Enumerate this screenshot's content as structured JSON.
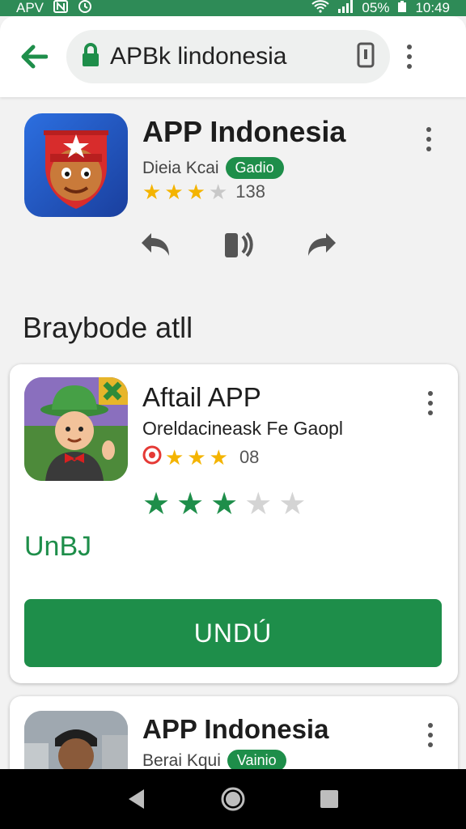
{
  "status": {
    "left_text": "APV",
    "battery": "05%",
    "time": "10:49"
  },
  "browser": {
    "url": "APBk lindonesia"
  },
  "top_app": {
    "title": "APP Indonesia",
    "developer": "Dieia Kcai",
    "badge": "Gadio",
    "rating_count": "138",
    "stars_filled": 3,
    "stars_total": 4
  },
  "section": {
    "heading": "Braybode atll"
  },
  "card1": {
    "title": "Aftail APP",
    "subtitle": "Oreldacineask Fe Gaopl",
    "rating_count": "08",
    "stars_filled": 3,
    "green_stars_filled": 3,
    "green_stars_total": 5,
    "link_text": "UnBJ",
    "button_label": "UNDÚ"
  },
  "card2": {
    "title": "APP Indonesia",
    "developer": "Berai Kqui",
    "badge": "Vainio"
  },
  "colors": {
    "accent": "#1e8e4a",
    "status_bar": "#2e8b57",
    "star": "#f4b400"
  }
}
